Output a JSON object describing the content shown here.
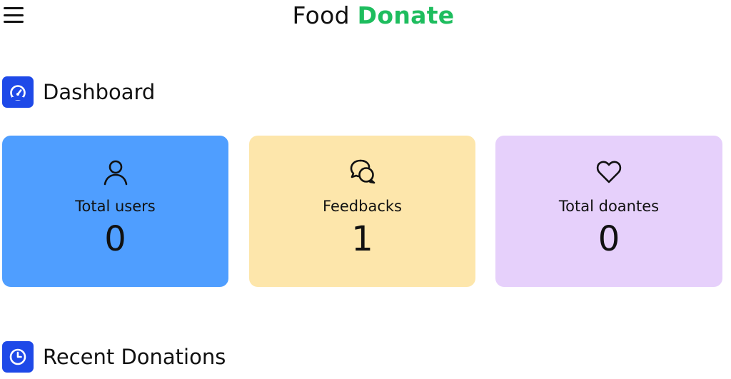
{
  "header": {
    "brand_prefix": "Food",
    "brand_accent": "Donate",
    "accent_color": "#1ebd5e",
    "menu_icon": "hamburger-menu-icon"
  },
  "dashboard": {
    "title": "Dashboard",
    "icon": "speedometer-icon",
    "cards": [
      {
        "label": "Total users",
        "value": "0",
        "icon": "user-icon",
        "color": "#4f9eff"
      },
      {
        "label": "Feedbacks",
        "value": "1",
        "icon": "chat-bubbles-icon",
        "color": "#fde6ab"
      },
      {
        "label": "Total doantes",
        "value": "0",
        "icon": "heart-icon",
        "color": "#e6d0fb"
      }
    ]
  },
  "recent": {
    "title": "Recent Donations",
    "icon": "clock-icon"
  },
  "icon_badge_color": "#1e49e8"
}
